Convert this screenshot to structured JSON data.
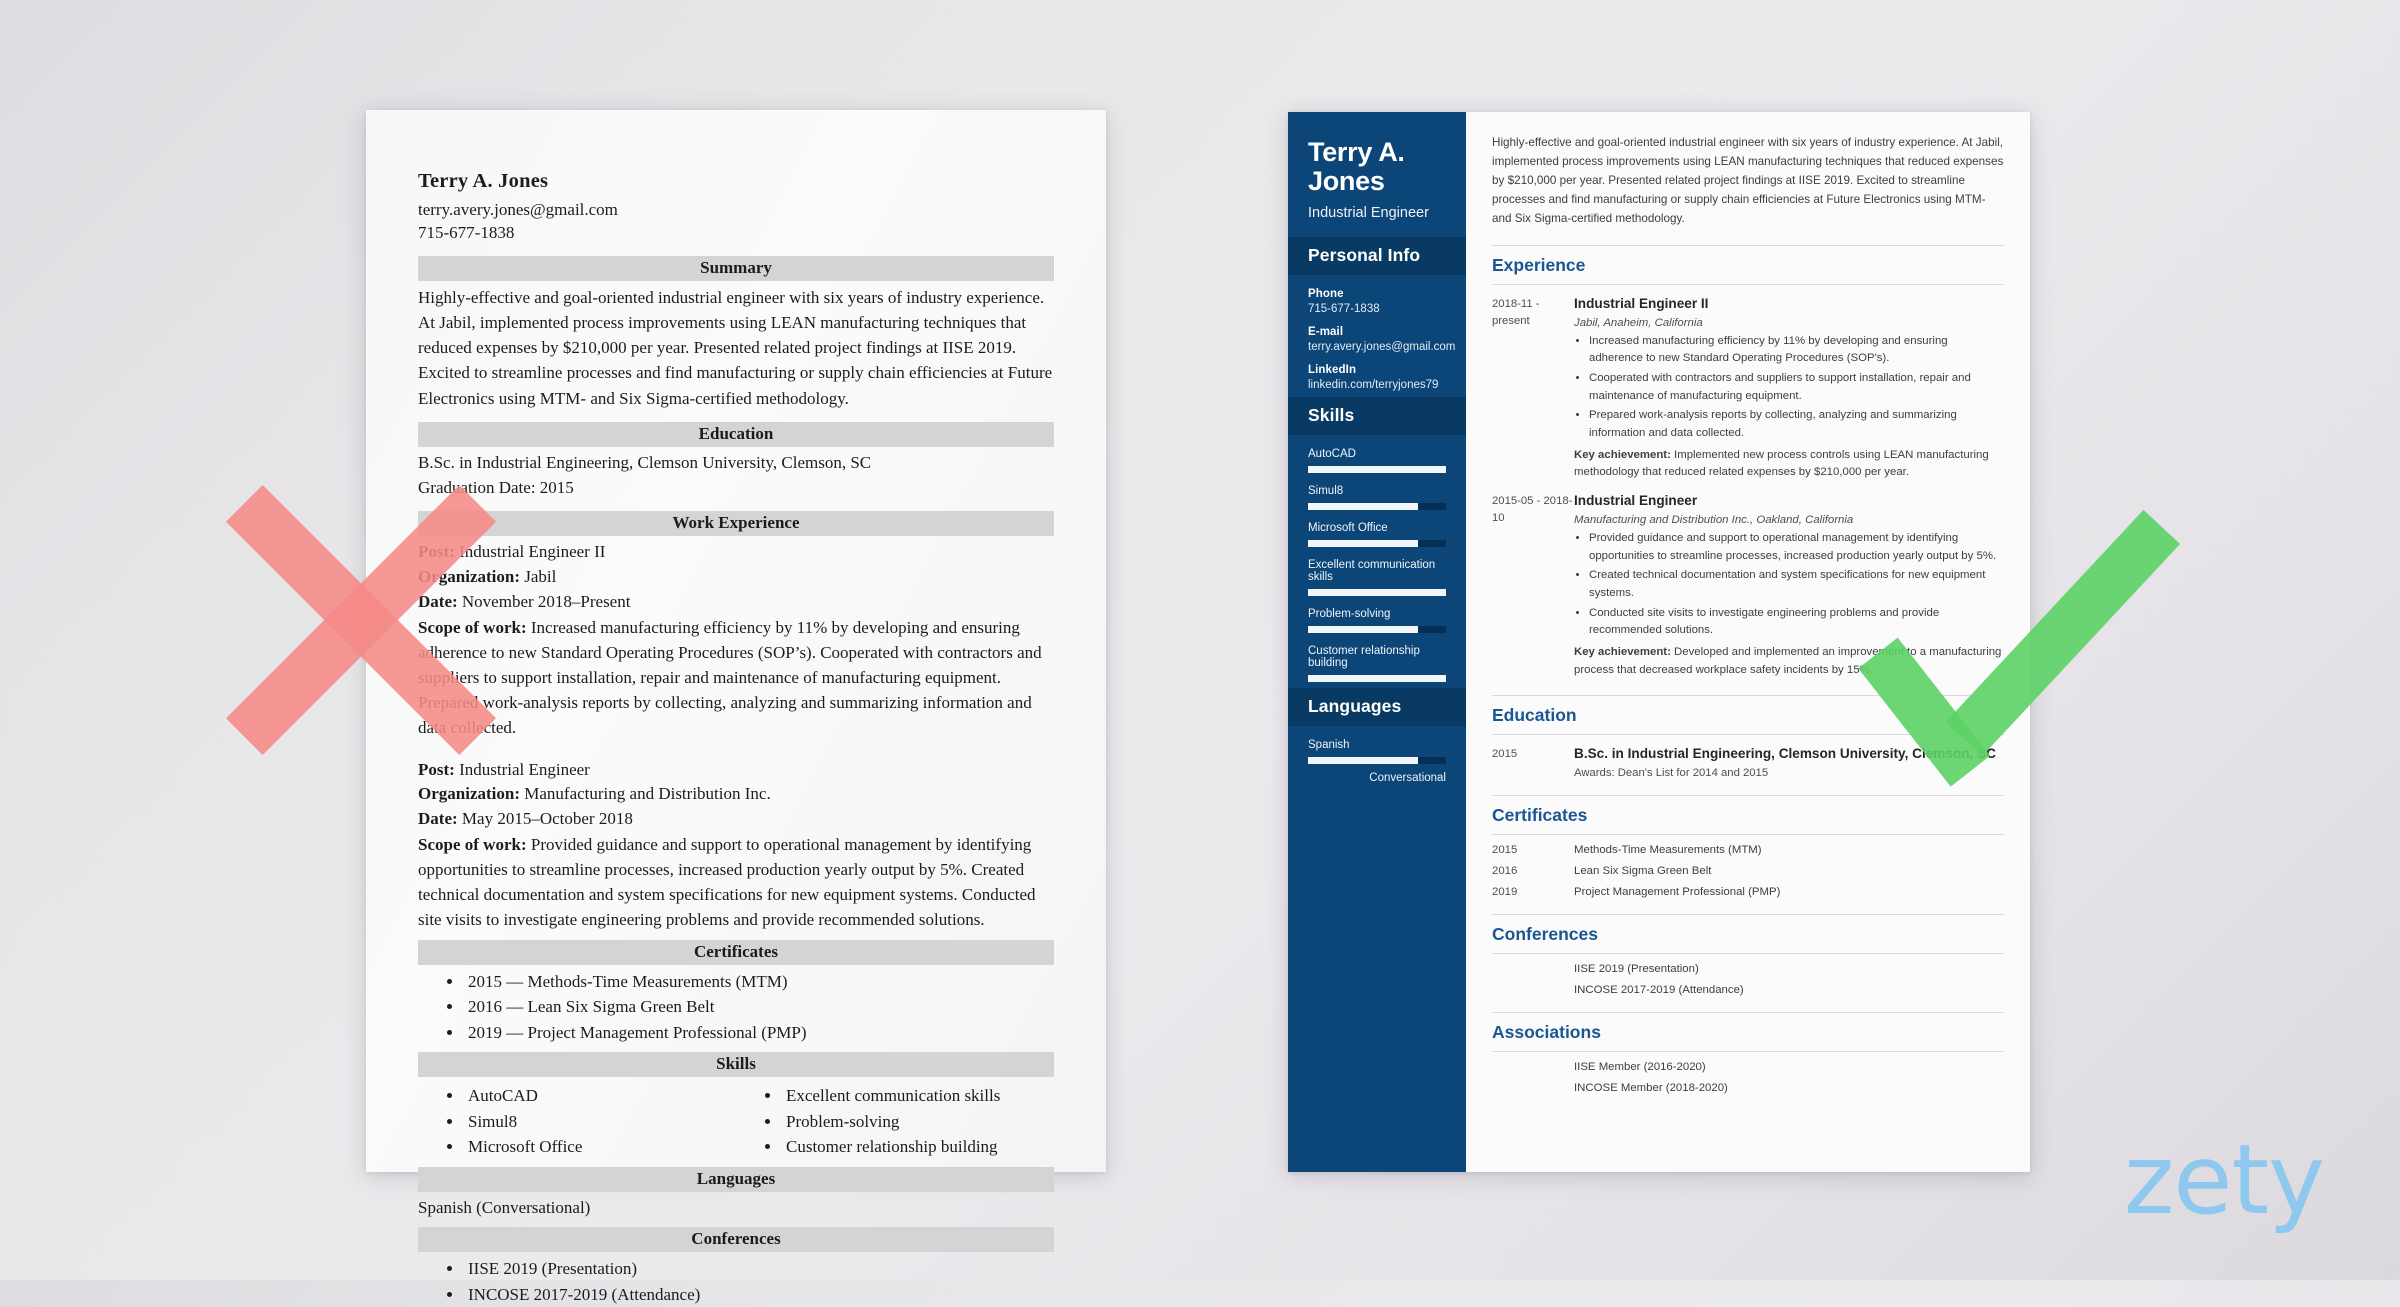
{
  "bad_resume": {
    "name": "Terry A. Jones",
    "email": "terry.avery.jones@gmail.com",
    "phone": "715-677-1838",
    "sections": {
      "summary_title": "Summary",
      "summary_text": "Highly-effective and goal-oriented industrial engineer with six years of industry experience. At Jabil, implemented process improvements using LEAN manufacturing techniques that reduced expenses by $210,000 per year. Presented related project findings at IISE 2019. Excited to streamline processes and find manufacturing or supply chain efficiencies at Future Electronics using MTM- and Six Sigma-certified methodology.",
      "education_title": "Education",
      "education_degree": "B.Sc. in Industrial Engineering, Clemson University, Clemson, SC",
      "education_date": "Graduation Date: 2015",
      "work_title": "Work Experience",
      "jobs": [
        {
          "post_label": "Post:",
          "post_value": " Industrial Engineer II",
          "org_label": "Organization:",
          "org_value": " Jabil",
          "date_label": "Date:",
          "date_value": " November 2018–Present",
          "scope_label": "Scope of work:",
          "scope_value": " Increased manufacturing efficiency by 11% by developing and ensuring adherence to new Standard Operating Procedures (SOP’s). Cooperated with contractors and suppliers to support installation, repair and maintenance of manufacturing equipment. Prepared work-analysis reports by collecting, analyzing and summarizing information and data collected."
        },
        {
          "post_label": "Post:",
          "post_value": " Industrial Engineer",
          "org_label": "Organization:",
          "org_value": " Manufacturing and Distribution Inc.",
          "date_label": "Date:",
          "date_value": " May 2015–October 2018",
          "scope_label": "Scope of work:",
          "scope_value": " Provided guidance and support to operational management by identifying opportunities to streamline processes, increased production yearly output by 5%. Created technical documentation and system specifications for new equipment systems. Conducted site visits to investigate engineering problems and provide recommended solutions."
        }
      ],
      "certificates_title": "Certificates",
      "certificates": [
        "2015 — Methods-Time Measurements (MTM)",
        "2016 — Lean Six Sigma Green Belt",
        "2019 — Project Management Professional (PMP)"
      ],
      "skills_title": "Skills",
      "skills_left": [
        "AutoCAD",
        "Simul8",
        "Microsoft Office"
      ],
      "skills_right": [
        "Excellent communication skills",
        "Problem-solving",
        "Customer relationship building"
      ],
      "languages_title": "Languages",
      "languages_text": "Spanish (Conversational)",
      "conferences_title": "Conferences",
      "conferences": [
        "IISE 2019 (Presentation)",
        "INCOSE 2017-2019 (Attendance)"
      ]
    }
  },
  "good_resume": {
    "sidebar": {
      "name": "Terry A. Jones",
      "role": "Industrial Engineer",
      "personal_info_title": "Personal Info",
      "info": [
        {
          "label": "Phone",
          "value": "715-677-1838"
        },
        {
          "label": "E-mail",
          "value": "terry.avery.jones@gmail.com"
        },
        {
          "label": "LinkedIn",
          "value": "linkedin.com/terryjones79"
        }
      ],
      "skills_title": "Skills",
      "skills": [
        {
          "name": "AutoCAD",
          "level": 100
        },
        {
          "name": "Simul8",
          "level": 80
        },
        {
          "name": "Microsoft Office",
          "level": 80
        },
        {
          "name": "Excellent communication skills",
          "level": 100
        },
        {
          "name": "Problem-solving",
          "level": 80
        },
        {
          "name": "Customer relationship building",
          "level": 100
        }
      ],
      "languages_title": "Languages",
      "languages": [
        {
          "name": "Spanish",
          "level": 80,
          "proficiency": "Conversational"
        }
      ]
    },
    "main": {
      "summary": "Highly-effective and goal-oriented industrial engineer with six years of industry experience. At Jabil, implemented process improvements using LEAN manufacturing techniques that reduced expenses by $210,000 per year. Presented related project findings at IISE 2019. Excited to streamline processes and find manufacturing or supply chain efficiencies at Future Electronics using MTM- and Six Sigma-certified methodology.",
      "experience_title": "Experience",
      "experience": [
        {
          "date": "2018-11 - present",
          "title": "Industrial Engineer II",
          "company": "Jabil, Anaheim, California",
          "bullets": [
            "Increased manufacturing efficiency by 11% by developing and ensuring adherence to new Standard Operating Procedures (SOP's).",
            "Cooperated with contractors and suppliers to support installation, repair and maintenance of manufacturing equipment.",
            "Prepared work-analysis reports by collecting, analyzing and summarizing information and data collected."
          ],
          "key_label": "Key achievement:",
          "key_text": " Implemented new process controls using LEAN manufacturing methodology that reduced related expenses by $210,000 per year."
        },
        {
          "date": "2015-05 - 2018-10",
          "title": "Industrial Engineer",
          "company": "Manufacturing and Distribution Inc., Oakland, California",
          "bullets": [
            "Provided guidance and support to operational management by identifying opportunities to streamline processes, increased production yearly output by 5%.",
            "Created technical documentation and system specifications for new equipment systems.",
            "Conducted site visits to investigate engineering problems and provide recommended solutions."
          ],
          "key_label": "Key achievement:",
          "key_text": " Developed and implemented an improvement to a manufacturing process that decreased workplace safety incidents by 15%."
        }
      ],
      "education_title": "Education",
      "education": [
        {
          "date": "2015",
          "degree": "B.Sc. in Industrial Engineering, Clemson University, Clemson, SC",
          "awards": "Awards: Dean's List for 2014 and 2015"
        }
      ],
      "certificates_title": "Certificates",
      "certificates": [
        {
          "date": "2015",
          "name": "Methods-Time Measurements (MTM)"
        },
        {
          "date": "2016",
          "name": "Lean Six Sigma Green Belt"
        },
        {
          "date": "2019",
          "name": "Project Management Professional (PMP)"
        }
      ],
      "conferences_title": "Conferences",
      "conferences": [
        {
          "date": "",
          "name": "IISE 2019 (Presentation)"
        },
        {
          "date": "",
          "name": "INCOSE 2017-2019 (Attendance)"
        }
      ],
      "associations_title": "Associations",
      "associations": [
        {
          "date": "",
          "name": "IISE Member (2016-2020)"
        },
        {
          "date": "",
          "name": "INCOSE Member (2018-2020)"
        }
      ]
    }
  },
  "marks": {
    "cross_label": "red-cross-reject",
    "check_label": "green-check-approve",
    "cross_color": "#f58a86",
    "check_color": "#5cd266"
  },
  "branding": {
    "logo_text": "zety",
    "logo_color": "#8fc8ee"
  }
}
